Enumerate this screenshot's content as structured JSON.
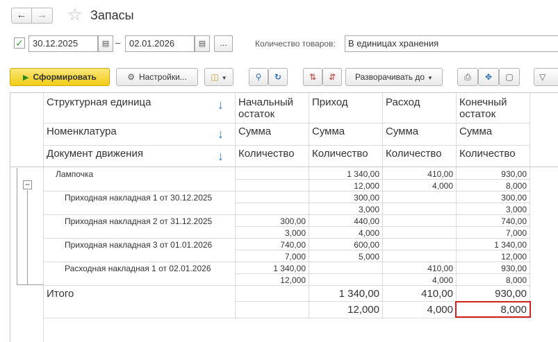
{
  "window": {
    "back_icon": "arrow-left-icon",
    "forward_icon": "arrow-right-icon",
    "star_icon": "star-icon",
    "title": "Запасы"
  },
  "filters": {
    "date_from": "30.12.2025",
    "date_to": "02.01.2026",
    "dash": "–",
    "dots_label": "...",
    "qty_label": "Количество товаров:",
    "qty_value": "В единицах хранения"
  },
  "toolbar": {
    "generate_label": "Сформировать",
    "settings_label": "Настройки...",
    "expand_label": "Разворачивать до"
  },
  "grid": {
    "group_headers": [
      "Структурная единица",
      "Номенклатура",
      "Документ движения"
    ],
    "col_headers": [
      [
        "Начальный",
        "остаток"
      ],
      [
        "Приход",
        ""
      ],
      [
        "Расход",
        ""
      ],
      [
        "Конечный",
        "остаток"
      ]
    ],
    "sum_label": "Сумма",
    "qty_label": "Количество",
    "rows": [
      {
        "label": "Лампочка",
        "level": 1,
        "sum": [
          "",
          "1 340,00",
          "410,00",
          "930,00"
        ],
        "qty": [
          "",
          "12,000",
          "4,000",
          "8,000"
        ]
      },
      {
        "label": "Приходная накладная 1 от 30.12.2025",
        "level": 2,
        "sum": [
          "",
          "300,00",
          "",
          "300,00"
        ],
        "qty": [
          "",
          "3,000",
          "",
          "3,000"
        ]
      },
      {
        "label": "Приходная накладная 2 от 31.12.2025",
        "level": 2,
        "sum": [
          "300,00",
          "440,00",
          "",
          "740,00"
        ],
        "qty": [
          "3,000",
          "4,000",
          "",
          "7,000"
        ]
      },
      {
        "label": "Приходная накладная 3 от 01.01.2026",
        "level": 2,
        "sum": [
          "740,00",
          "600,00",
          "",
          "1 340,00"
        ],
        "qty": [
          "7,000",
          "5,000",
          "",
          "12,000"
        ]
      },
      {
        "label": "Расходная накладная 1 от 02.01.2026",
        "level": 2,
        "sum": [
          "1 340,00",
          "",
          "410,00",
          "930,00"
        ],
        "qty": [
          "12,000",
          "",
          "4,000",
          "8,000"
        ]
      }
    ],
    "total": {
      "label": "Итого",
      "sum": [
        "",
        "1 340,00",
        "410,00",
        "930,00"
      ],
      "qty": [
        "",
        "12,000",
        "4,000",
        "8,000"
      ]
    },
    "collapse_symbol": "−",
    "sort_arrow": "↓"
  },
  "colors": {
    "accent_yellow": "#f1cc16",
    "highlight_red": "#d22020",
    "arrow_blue": "#2a7bd0"
  }
}
